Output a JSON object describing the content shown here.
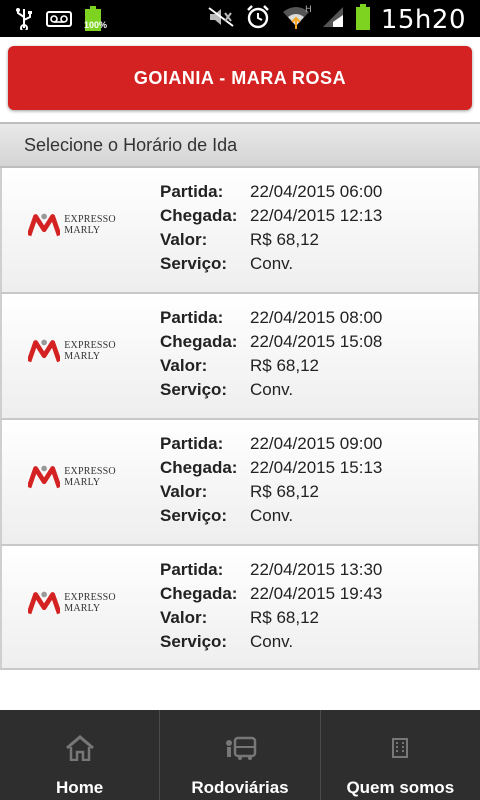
{
  "status_bar": {
    "time": "15h20",
    "battery_pct": "100%",
    "icons": [
      "usb-icon",
      "voicemail-icon",
      "battery-icon",
      "mute-icon",
      "alarm-icon",
      "wifi-icon",
      "signal-icon",
      "battery-icon"
    ]
  },
  "title": "GOIANIA - MARA ROSA",
  "list_header": "Selecione o Horário de Ida",
  "labels": {
    "partida": "Partida:",
    "chegada": "Chegada:",
    "valor": "Valor:",
    "servico": "Serviço:"
  },
  "company": "EXPRESSO MARLY",
  "trips": [
    {
      "partida": "22/04/2015 06:00",
      "chegada": "22/04/2015 12:13",
      "valor": "R$ 68,12",
      "servico": "Conv."
    },
    {
      "partida": "22/04/2015 08:00",
      "chegada": "22/04/2015 15:08",
      "valor": "R$ 68,12",
      "servico": "Conv."
    },
    {
      "partida": "22/04/2015 09:00",
      "chegada": "22/04/2015 15:13",
      "valor": "R$ 68,12",
      "servico": "Conv."
    },
    {
      "partida": "22/04/2015 13:30",
      "chegada": "22/04/2015 19:43",
      "valor": "R$ 68,12",
      "servico": "Conv."
    }
  ],
  "nav": [
    {
      "label": "Home",
      "icon": "home-icon"
    },
    {
      "label": "Rodoviárias",
      "icon": "bus-icon"
    },
    {
      "label": "Quem somos",
      "icon": "building-icon"
    }
  ],
  "colors": {
    "accent": "#d42222",
    "navbar": "#2e2e2e",
    "battery": "#7ed321"
  }
}
